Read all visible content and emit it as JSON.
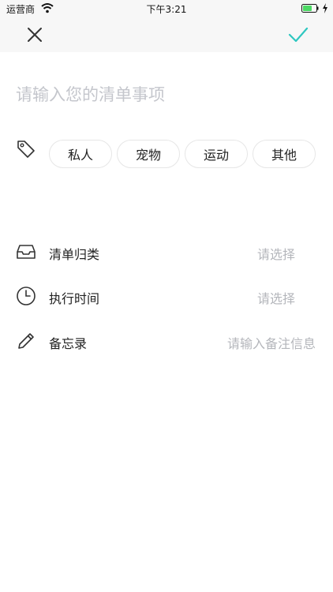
{
  "status_bar": {
    "carrier": "运营商",
    "time": "下午3:21"
  },
  "nav": {
    "close_icon": "close-icon",
    "confirm_icon": "checkmark-icon",
    "accent_color": "#2ec7c0"
  },
  "title_input": {
    "placeholder": "请输入您的清单事项",
    "value": ""
  },
  "tags": {
    "icon": "tag-icon",
    "items": [
      {
        "label": "私人"
      },
      {
        "label": "宠物"
      },
      {
        "label": "运动"
      },
      {
        "label": "其他"
      }
    ]
  },
  "rows": [
    {
      "icon": "inbox-icon",
      "label": "清单归类",
      "value": "请选择"
    },
    {
      "icon": "clock-icon",
      "label": "执行时间",
      "value": "请选择"
    },
    {
      "icon": "pencil-icon",
      "label": "备忘录",
      "value": "请输入备注信息"
    }
  ]
}
